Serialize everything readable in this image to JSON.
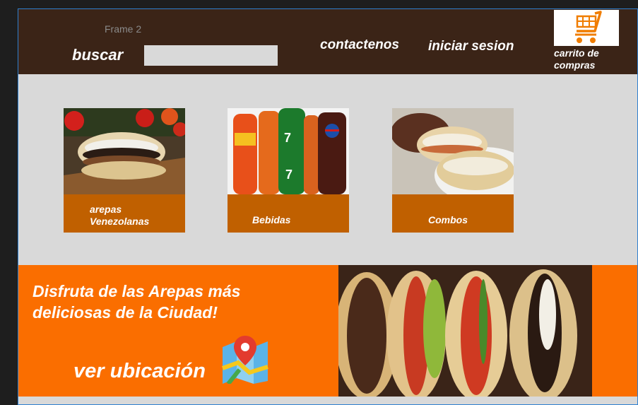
{
  "canvas": {
    "frame_label": "Frame 2"
  },
  "header": {
    "search_label": "buscar",
    "search_placeholder": "",
    "contact_label": "contactenos",
    "login_label": "iniciar sesion",
    "cart_label_line1": "carrito de",
    "cart_label_line2": "compras",
    "cart_icon": "shopping-cart-icon"
  },
  "categories": [
    {
      "label_line1": "arepas",
      "label_line2": "Venezolanas",
      "image": "arepa-photo"
    },
    {
      "label_line1": "Bebidas",
      "label_line2": "",
      "image": "drinks-photo"
    },
    {
      "label_line1": "Combos",
      "label_line2": "",
      "image": "combos-photo"
    }
  ],
  "banner": {
    "title_line1": "Disfruta de las Arepas más",
    "title_line2": "deliciosas  de la Ciudad!",
    "location_label": "ver ubicación",
    "map_icon": "map-pin-icon",
    "image": "arepas-banner-photo"
  },
  "colors": {
    "header_bg": "#3b2417",
    "category_bar": "#c06000",
    "banner_bg": "#fa6e00",
    "page_bg": "#d9d9d9",
    "cart_orange": "#f07d00"
  }
}
